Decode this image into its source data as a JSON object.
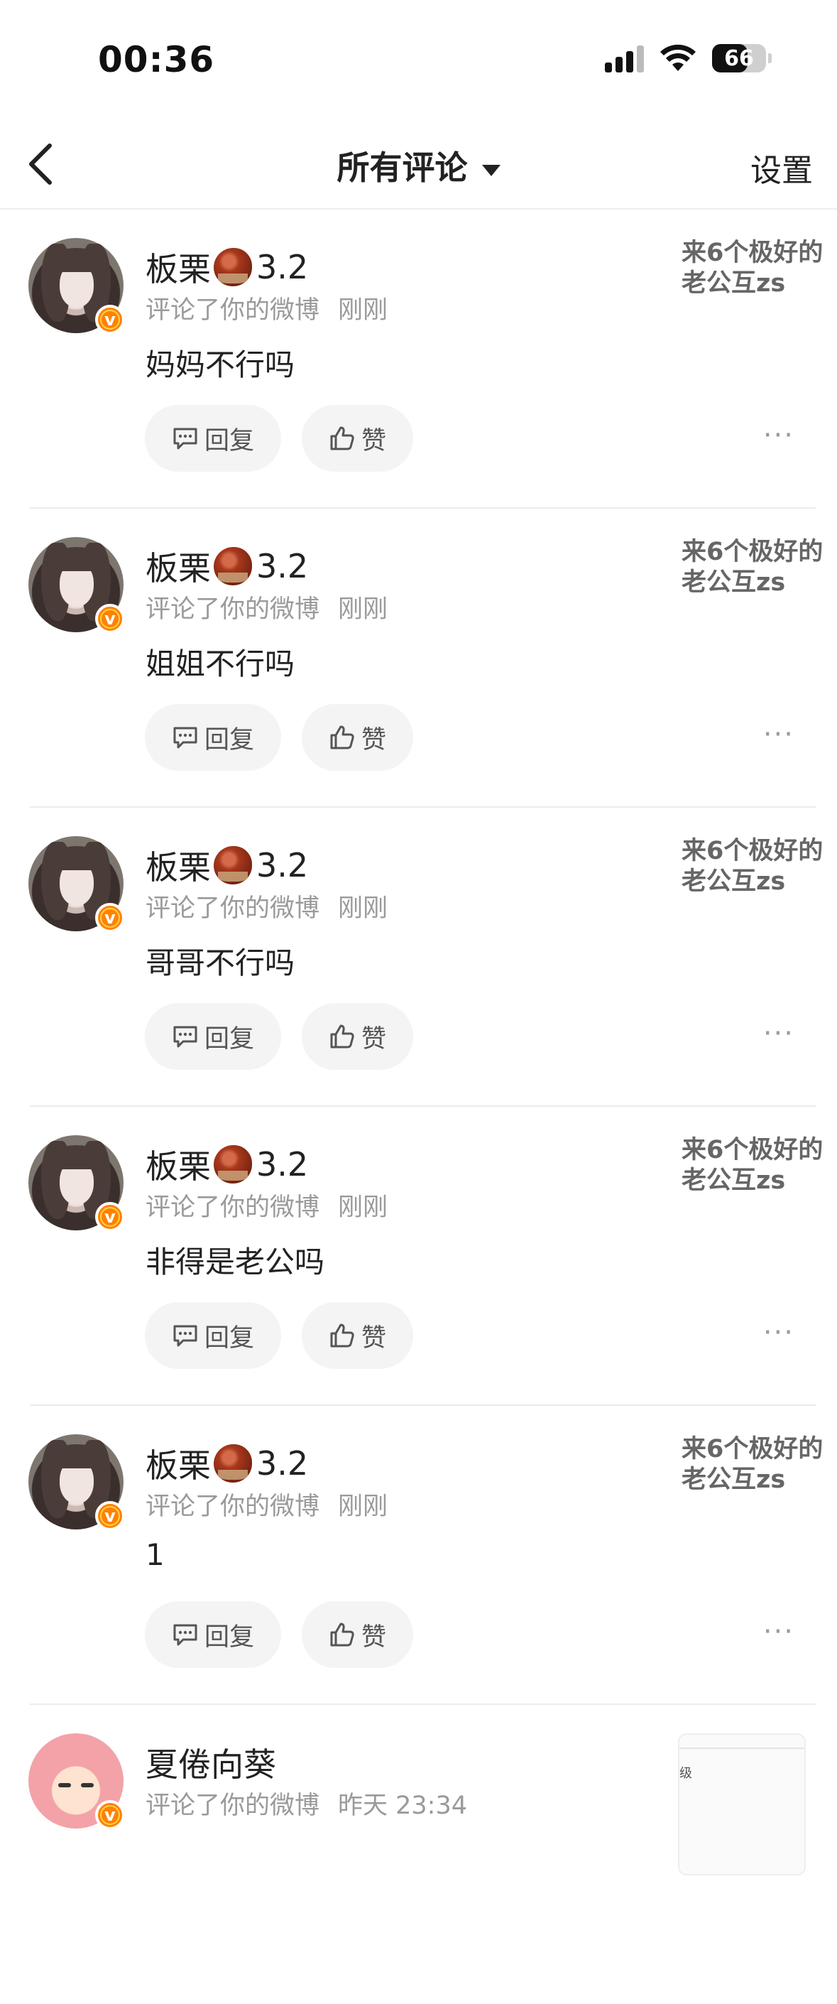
{
  "status_bar": {
    "time": "00:36",
    "battery": "66",
    "battery_level": 0.66
  },
  "nav": {
    "title": "所有评论",
    "settings": "设置"
  },
  "comments": [
    {
      "user": "板栗",
      "badge_value": "3.2",
      "action": "评论了你的微博",
      "time": "刚刚",
      "text": "妈妈不行吗",
      "reply_label": "回复",
      "like_label": "赞",
      "quote": "来6个极好的老公互zs"
    },
    {
      "user": "板栗",
      "badge_value": "3.2",
      "action": "评论了你的微博",
      "time": "刚刚",
      "text": "姐姐不行吗",
      "reply_label": "回复",
      "like_label": "赞",
      "quote": "来6个极好的老公互zs"
    },
    {
      "user": "板栗",
      "badge_value": "3.2",
      "action": "评论了你的微博",
      "time": "刚刚",
      "text": "哥哥不行吗",
      "reply_label": "回复",
      "like_label": "赞",
      "quote": "来6个极好的老公互zs"
    },
    {
      "user": "板栗",
      "badge_value": "3.2",
      "action": "评论了你的微博",
      "time": "刚刚",
      "text": "非得是老公吗",
      "reply_label": "回复",
      "like_label": "赞",
      "quote": "来6个极好的老公互zs"
    },
    {
      "user": "板栗",
      "badge_value": "3.2",
      "action": "评论了你的微博",
      "time": "刚刚",
      "text": "1",
      "reply_label": "回复",
      "like_label": "赞",
      "quote": "来6个极好的老公互zs"
    }
  ],
  "last_comment": {
    "user": "夏倦向葵",
    "action": "评论了你的微博",
    "time": "昨天 23:34",
    "thumb_text": "级"
  },
  "colors": {
    "vip_orange": "#ff8200",
    "meta_gray": "#9a9a9a",
    "button_bg": "#f4f4f4"
  },
  "icons": {
    "back": "chevron-left-icon",
    "dropdown": "caret-down-icon",
    "reply": "comment-icon",
    "like": "thumbs-up-icon",
    "more": "more-dots-icon",
    "verified": "v-badge-icon"
  }
}
